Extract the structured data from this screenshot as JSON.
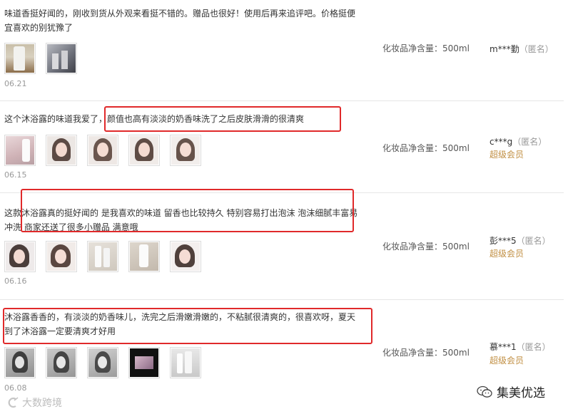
{
  "reviews": [
    {
      "text": "味道香挺好闻的，刚收到货从外观来看挺不错的。赠品也很好！使用后再来追评吧。价格挺便宜喜欢的别犹豫了",
      "date": "06.21",
      "spec": "化妆品净含量：500ml",
      "user": "m***勤",
      "anon": "（匿名）",
      "member": "",
      "thumbs": [
        "bottle",
        "bottles-dark"
      ]
    },
    {
      "text": "这个沐浴露的味道我爱了，颜值也高有淡淡的奶香味洗了之后皮肤滑滑的很清爽",
      "date": "06.15",
      "spec": "化妆品净含量：500ml",
      "user": "c***g",
      "anon": "（匿名）",
      "member": "超级会员",
      "thumbs": [
        "bottles-pink",
        "portrait",
        "portrait",
        "portrait",
        "portrait"
      ]
    },
    {
      "text": "这款沐浴露真的挺好闻的 是我喜欢的味道 留香也比较持久 特别容易打出泡沫 泡沫细腻丰富易冲洗 商家还送了很多小赠品 满意哦",
      "date": "06.16",
      "spec": "化妆品净含量：500ml",
      "user": "彭***5",
      "anon": "（匿名）",
      "member": "超级会员",
      "thumbs": [
        "portrait",
        "portrait",
        "bottles-white",
        "bottle-white",
        "portrait"
      ]
    },
    {
      "text": "沐浴露香香的，有淡淡的奶香味儿，洗完之后滑嫩滑嫩的，不粘腻很清爽的，很喜欢呀，夏天到了沐浴露一定要清爽才好用",
      "date": "06.08",
      "spec": "化妆品净含量：500ml",
      "user": "慕***1",
      "anon": "（匿名）",
      "member": "超级会员",
      "thumbs": [
        "portrait-gray",
        "portrait-gray",
        "portrait-gray",
        "dark-photo",
        "bottle-gray"
      ]
    }
  ],
  "brand": {
    "name": "集美优选",
    "icon": "wechat-icon"
  },
  "watermark": {
    "text": "大数跨境",
    "icon": "logo-mark"
  },
  "colors": {
    "highlight": "#e0292a",
    "member": "#c18f43",
    "separator": "#e6e6e6"
  }
}
